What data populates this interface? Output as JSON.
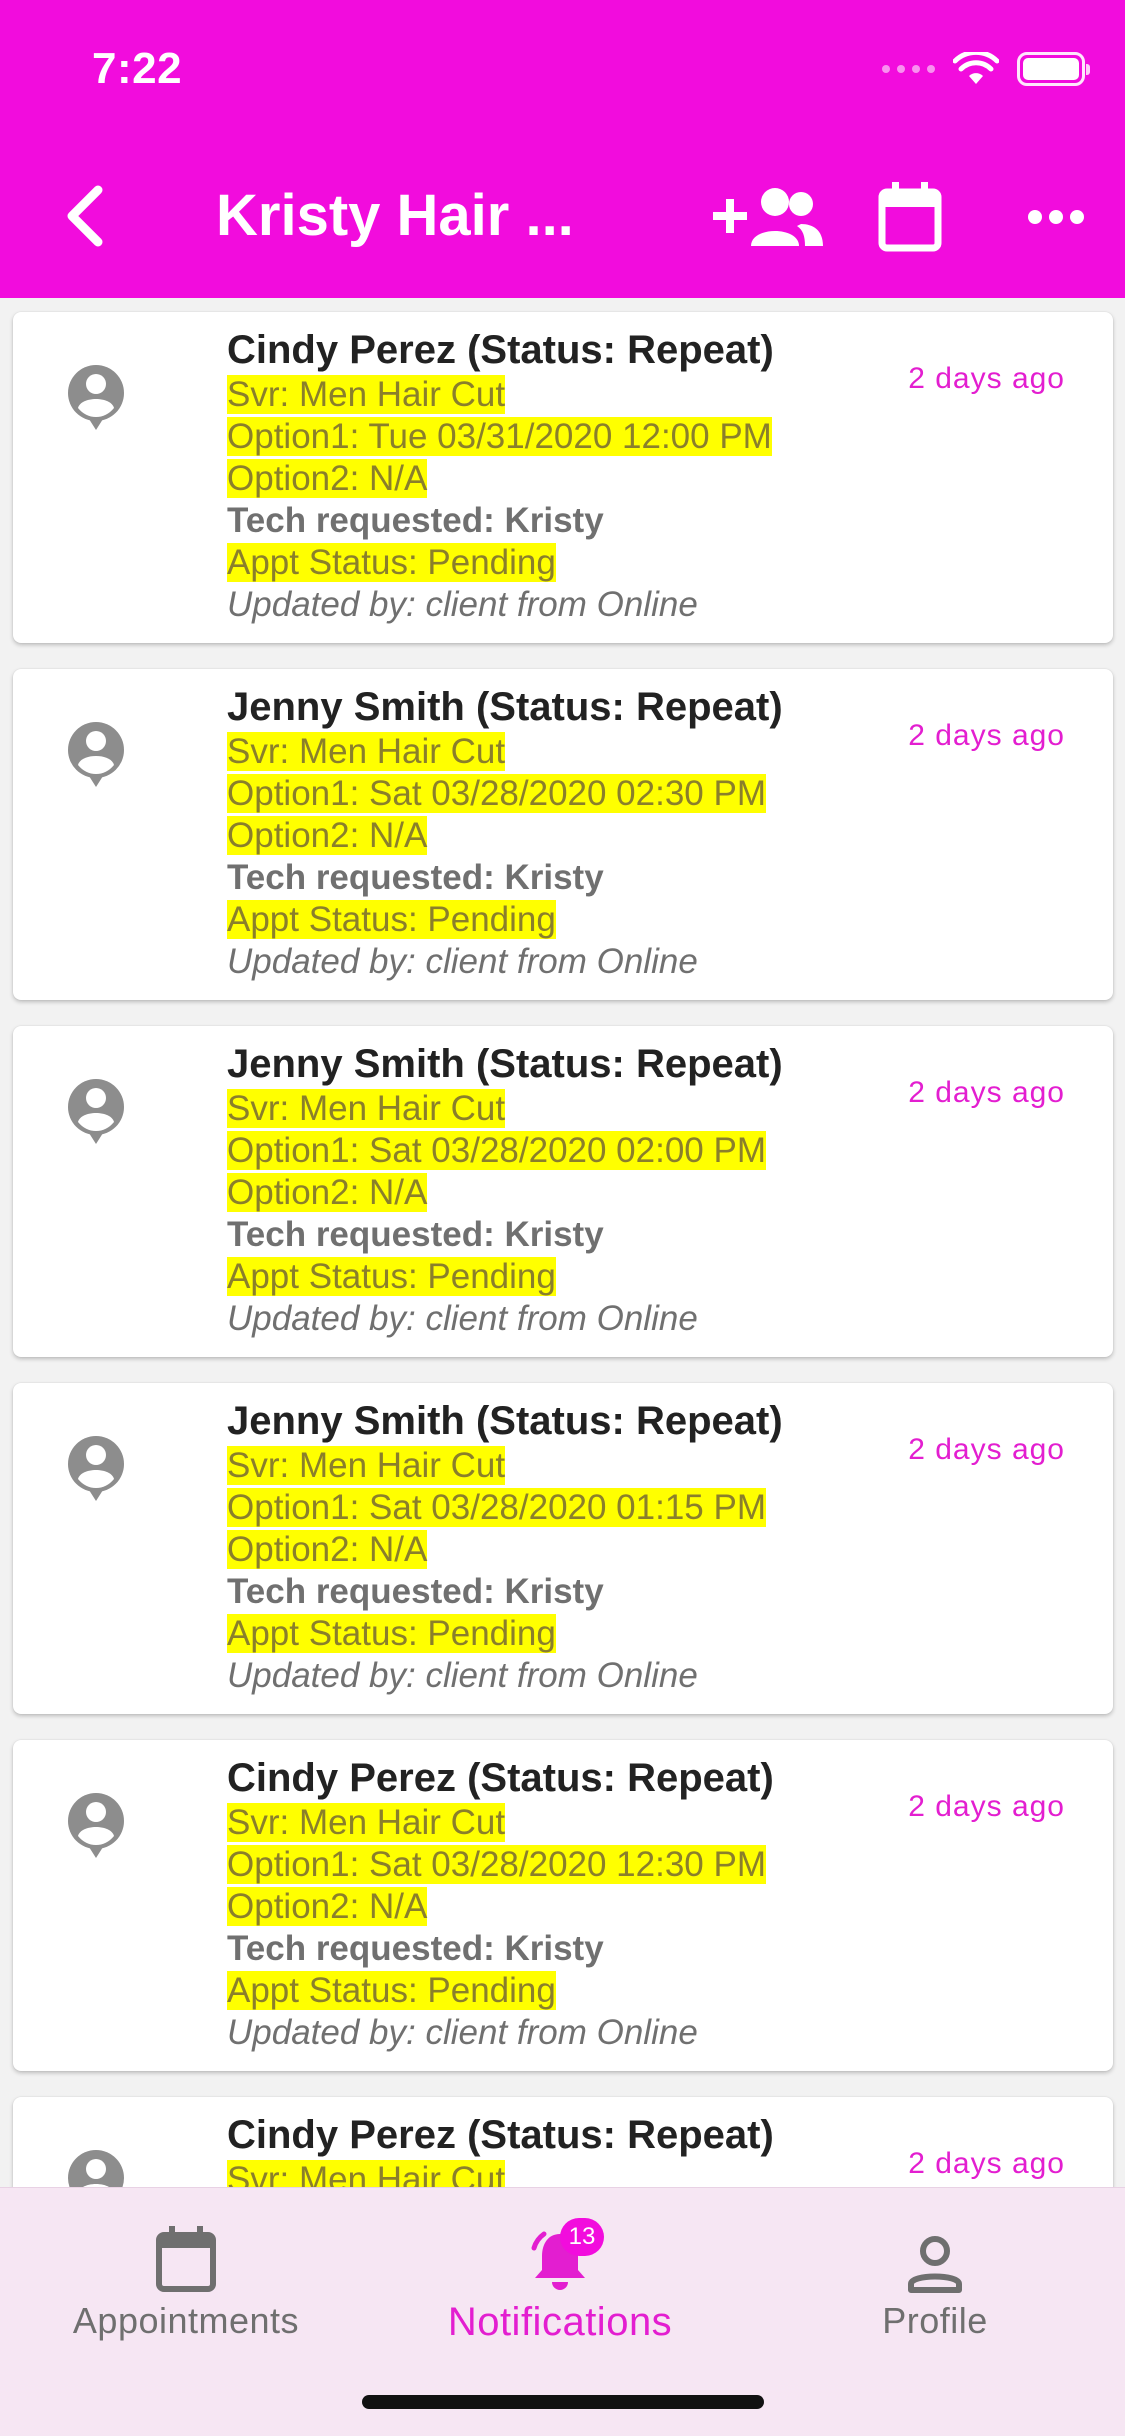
{
  "status_bar": {
    "time": "7:22"
  },
  "header": {
    "title": "Kristy Hair ...",
    "icons": {
      "back": "chevron-left-icon",
      "add_client": "person-add-icon",
      "calendar": "calendar-icon",
      "more": "more-horizontal-icon"
    },
    "background": "#f20cdd"
  },
  "notifications": [
    {
      "name": "Cindy Perez (Status: Repeat)",
      "service": "Svr: Men Hair Cut",
      "option1": "Option1: Tue 03/31/2020 12:00 PM",
      "option2": "Option2: N/A",
      "tech": "Tech requested: Kristy",
      "status": "Appt Status: Pending",
      "updated": "Updated by: client from Online",
      "time": "2 days ago"
    },
    {
      "name": "Jenny Smith (Status: Repeat)",
      "service": "Svr: Men Hair Cut",
      "option1": "Option1: Sat 03/28/2020 02:30 PM",
      "option2": "Option2: N/A",
      "tech": "Tech requested: Kristy",
      "status": "Appt Status: Pending",
      "updated": "Updated by: client from Online",
      "time": "2 days ago"
    },
    {
      "name": "Jenny Smith (Status: Repeat)",
      "service": "Svr: Men Hair Cut",
      "option1": "Option1: Sat 03/28/2020 02:00 PM",
      "option2": "Option2: N/A",
      "tech": "Tech requested: Kristy",
      "status": "Appt Status: Pending",
      "updated": "Updated by: client from Online",
      "time": "2 days ago"
    },
    {
      "name": "Jenny Smith (Status: Repeat)",
      "service": "Svr: Men Hair Cut",
      "option1": "Option1: Sat 03/28/2020 01:15 PM",
      "option2": "Option2: N/A",
      "tech": "Tech requested: Kristy",
      "status": "Appt Status: Pending",
      "updated": "Updated by: client from Online",
      "time": "2 days ago"
    },
    {
      "name": "Cindy Perez (Status: Repeat)",
      "service": "Svr: Men Hair Cut",
      "option1": "Option1: Sat 03/28/2020 12:30 PM",
      "option2": "Option2: N/A",
      "tech": "Tech requested: Kristy",
      "status": "Appt Status: Pending",
      "updated": "Updated by: client from Online",
      "time": "2 days ago"
    },
    {
      "name": "Cindy Perez (Status: Repeat)",
      "service": "Svr: Men Hair Cut",
      "option1": "",
      "option2": "",
      "tech": "",
      "status": "",
      "updated": "",
      "time": "2 days ago"
    }
  ],
  "bottom_nav": {
    "tabs": [
      {
        "label": "Appointments",
        "icon": "calendar-icon"
      },
      {
        "label": "Notifications",
        "icon": "bell-icon",
        "badge": "13",
        "active": true
      },
      {
        "label": "Profile",
        "icon": "person-icon"
      }
    ],
    "accent": "#e31ed0"
  }
}
